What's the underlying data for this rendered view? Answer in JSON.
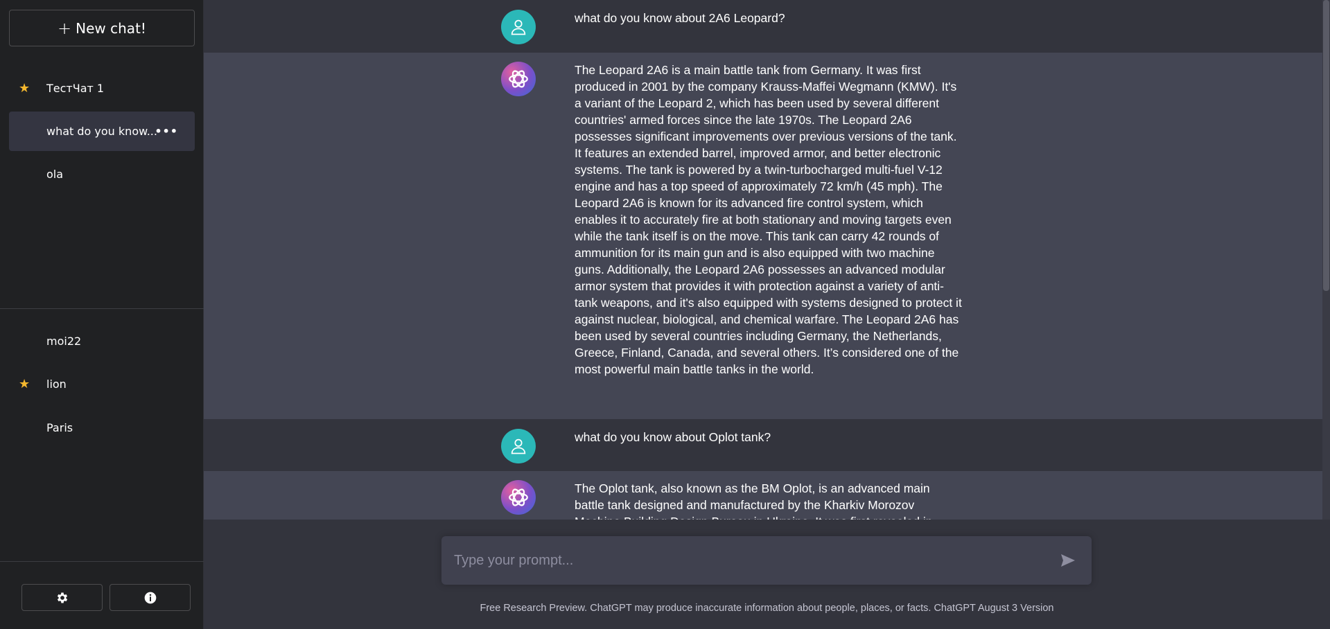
{
  "sidebar": {
    "new_chat_label": "New chat!",
    "new_chat_icon": "plus-icon",
    "pinned": [
      {
        "label": "ТестЧат 1",
        "starred": true
      },
      {
        "label": "what do you know...",
        "starred": false,
        "active": true,
        "menu": "•••"
      },
      {
        "label": "ola",
        "starred": false
      }
    ],
    "others": [
      {
        "label": "moi22",
        "starred": false
      },
      {
        "label": "lion",
        "starred": true
      },
      {
        "label": "Paris",
        "starred": false
      }
    ],
    "settings_icon": "gear-icon",
    "info_icon": "info-icon"
  },
  "conversation": [
    {
      "role": "user",
      "text": "what do you know about 2A6 Leopard?"
    },
    {
      "role": "assistant",
      "text": "The Leopard 2A6 is a main battle tank from Germany. It was first produced in 2001 by the company Krauss-Maffei Wegmann (KMW). It's a variant of the Leopard 2, which has been used by several different countries' armed forces since the late 1970s. The Leopard 2A6 possesses significant improvements over previous versions of the tank. It features an extended barrel, improved armor, and better electronic systems. The tank is powered by a twin-turbocharged multi-fuel V-12 engine and has a top speed of approximately 72 km/h (45 mph). The Leopard 2A6 is known for its advanced fire control system, which enables it to accurately fire at both stationary and moving targets even while the tank itself is on the move. This tank can carry 42 rounds of ammunition for its main gun and is also equipped with two machine guns. Additionally, the Leopard 2A6 possesses an advanced modular armor system that provides it with protection against a variety of anti-tank weapons, and it's also equipped with systems designed to protect it against nuclear, biological, and chemical warfare. The Leopard 2A6 has been used by several countries including Germany, the Netherlands, Greece, Finland, Canada, and several others. It’s considered one of the most powerful main battle tanks in the world."
    },
    {
      "role": "user",
      "text": "what do you know about Oplot tank?"
    },
    {
      "role": "assistant",
      "text": "The Oplot tank, also known as the BM Oplot, is an advanced main battle tank designed and manufactured by the Kharkiv Morozov Machine Building Design Bureau in Ukraine. It was first revealed in"
    }
  ],
  "message_actions": {
    "copy_icon": "copy-icon",
    "like_icon": "thumbs-up-icon"
  },
  "prompt": {
    "placeholder": "Type your prompt...",
    "send_icon": "send-icon"
  },
  "footer": "Free Research Preview. ChatGPT may produce inaccurate information about people, places, or facts. ChatGPT August 3 Version",
  "colors": {
    "sidebar_bg": "#202123",
    "user_row_bg": "#33343d",
    "assistant_row_bg": "#444654",
    "star": "#f5b82e",
    "user_avatar": "#2bb8b8"
  }
}
